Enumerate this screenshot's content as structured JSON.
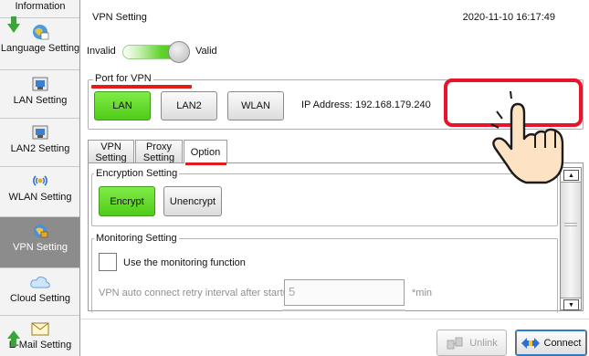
{
  "sidebar": {
    "items": [
      {
        "label": "Information",
        "icon": "info-icon"
      },
      {
        "label": "Language Setting",
        "icon": "language-icon"
      },
      {
        "label": "LAN Setting",
        "icon": "lan-icon"
      },
      {
        "label": "LAN2 Setting",
        "icon": "lan2-icon"
      },
      {
        "label": "WLAN Setting",
        "icon": "wlan-icon"
      },
      {
        "label": "VPN Setting",
        "icon": "vpn-icon",
        "active": true
      },
      {
        "label": "Cloud Setting",
        "icon": "cloud-icon"
      },
      {
        "label": "E-Mail Setting",
        "icon": "email-icon"
      }
    ]
  },
  "header": {
    "title": "VPN Setting",
    "datetime": "2020-11-10 16:17:49"
  },
  "toggle": {
    "off_label": "Invalid",
    "on_label": "Valid",
    "state": "Valid"
  },
  "port": {
    "legend": "Port for VPN",
    "buttons": [
      "LAN",
      "LAN2",
      "WLAN"
    ],
    "selected": "LAN",
    "ip_address": "IP Address: 192.168.179.240"
  },
  "tabs": {
    "vpn": "VPN Setting",
    "proxy": "Proxy Setting",
    "option": "Option",
    "active": "Option"
  },
  "encryption": {
    "legend": "Encryption Setting",
    "encrypt_label": "Encrypt",
    "unencrypt_label": "Unencrypt",
    "selected": "Encrypt"
  },
  "monitoring": {
    "legend": "Monitoring Setting",
    "checkbox_label": "Use the monitoring function",
    "checked": false,
    "retry_label": "VPN auto connect retry interval after startup",
    "retry_value": "5",
    "retry_unit": "*min"
  },
  "footer": {
    "unlink_label": "Unlink",
    "connect_label": "Connect"
  },
  "colors": {
    "accent_green": "#4fcb18",
    "highlight_red": "#e8132c",
    "sidebar_active": "#8c8c8c"
  }
}
